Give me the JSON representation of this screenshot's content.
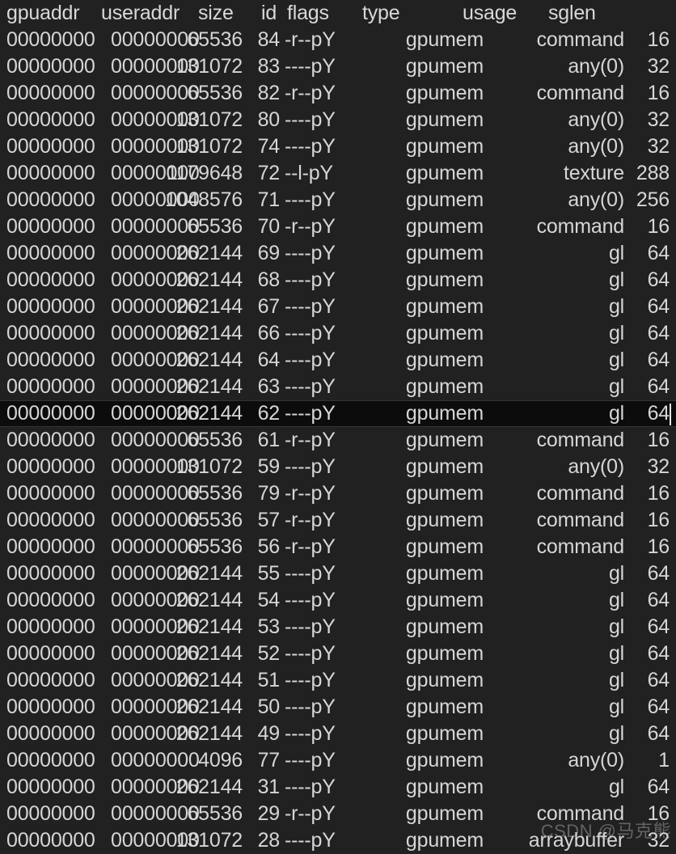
{
  "view": {
    "background_color": "#212121",
    "text_color": "#d6d6d6",
    "selected_row_background": "#0c0c0c",
    "selected_row_border_color": "#343434"
  },
  "table": {
    "headers": {
      "gpuaddr": "gpuaddr",
      "useraddr": "useraddr",
      "size": "size",
      "id": "id",
      "flags": "flags",
      "type": "type",
      "usage": "usage",
      "sglen": "sglen"
    },
    "rows": [
      {
        "gpuaddr": "00000000",
        "useraddr": "00000000",
        "size": "65536",
        "id": "84",
        "flags": "-r--pY",
        "type": "gpumem",
        "usage": "command",
        "sglen": "16",
        "selected": false
      },
      {
        "gpuaddr": "00000000",
        "useraddr": "00000000",
        "size": "131072",
        "id": "83",
        "flags": "----pY",
        "type": "gpumem",
        "usage": "any(0)",
        "sglen": "32",
        "selected": false
      },
      {
        "gpuaddr": "00000000",
        "useraddr": "00000000",
        "size": "65536",
        "id": "82",
        "flags": "-r--pY",
        "type": "gpumem",
        "usage": "command",
        "sglen": "16",
        "selected": false
      },
      {
        "gpuaddr": "00000000",
        "useraddr": "00000000",
        "size": "131072",
        "id": "80",
        "flags": "----pY",
        "type": "gpumem",
        "usage": "any(0)",
        "sglen": "32",
        "selected": false
      },
      {
        "gpuaddr": "00000000",
        "useraddr": "00000000",
        "size": "131072",
        "id": "74",
        "flags": "----pY",
        "type": "gpumem",
        "usage": "any(0)",
        "sglen": "32",
        "selected": false
      },
      {
        "gpuaddr": "00000000",
        "useraddr": "00000000",
        "size": "1179648",
        "id": "72",
        "flags": "--l-pY",
        "type": "gpumem",
        "usage": "texture",
        "sglen": "288",
        "selected": false
      },
      {
        "gpuaddr": "00000000",
        "useraddr": "00000000",
        "size": "1048576",
        "id": "71",
        "flags": "----pY",
        "type": "gpumem",
        "usage": "any(0)",
        "sglen": "256",
        "selected": false
      },
      {
        "gpuaddr": "00000000",
        "useraddr": "00000000",
        "size": "65536",
        "id": "70",
        "flags": "-r--pY",
        "type": "gpumem",
        "usage": "command",
        "sglen": "16",
        "selected": false
      },
      {
        "gpuaddr": "00000000",
        "useraddr": "00000000",
        "size": "262144",
        "id": "69",
        "flags": "----pY",
        "type": "gpumem",
        "usage": "gl",
        "sglen": "64",
        "selected": false
      },
      {
        "gpuaddr": "00000000",
        "useraddr": "00000000",
        "size": "262144",
        "id": "68",
        "flags": "----pY",
        "type": "gpumem",
        "usage": "gl",
        "sglen": "64",
        "selected": false
      },
      {
        "gpuaddr": "00000000",
        "useraddr": "00000000",
        "size": "262144",
        "id": "67",
        "flags": "----pY",
        "type": "gpumem",
        "usage": "gl",
        "sglen": "64",
        "selected": false
      },
      {
        "gpuaddr": "00000000",
        "useraddr": "00000000",
        "size": "262144",
        "id": "66",
        "flags": "----pY",
        "type": "gpumem",
        "usage": "gl",
        "sglen": "64",
        "selected": false
      },
      {
        "gpuaddr": "00000000",
        "useraddr": "00000000",
        "size": "262144",
        "id": "64",
        "flags": "----pY",
        "type": "gpumem",
        "usage": "gl",
        "sglen": "64",
        "selected": false
      },
      {
        "gpuaddr": "00000000",
        "useraddr": "00000000",
        "size": "262144",
        "id": "63",
        "flags": "----pY",
        "type": "gpumem",
        "usage": "gl",
        "sglen": "64",
        "selected": false
      },
      {
        "gpuaddr": "00000000",
        "useraddr": "00000000",
        "size": "262144",
        "id": "62",
        "flags": "----pY",
        "type": "gpumem",
        "usage": "gl",
        "sglen": "64",
        "selected": true
      },
      {
        "gpuaddr": "00000000",
        "useraddr": "00000000",
        "size": "65536",
        "id": "61",
        "flags": "-r--pY",
        "type": "gpumem",
        "usage": "command",
        "sglen": "16",
        "selected": false
      },
      {
        "gpuaddr": "00000000",
        "useraddr": "00000000",
        "size": "131072",
        "id": "59",
        "flags": "----pY",
        "type": "gpumem",
        "usage": "any(0)",
        "sglen": "32",
        "selected": false
      },
      {
        "gpuaddr": "00000000",
        "useraddr": "00000000",
        "size": "65536",
        "id": "79",
        "flags": "-r--pY",
        "type": "gpumem",
        "usage": "command",
        "sglen": "16",
        "selected": false
      },
      {
        "gpuaddr": "00000000",
        "useraddr": "00000000",
        "size": "65536",
        "id": "57",
        "flags": "-r--pY",
        "type": "gpumem",
        "usage": "command",
        "sglen": "16",
        "selected": false
      },
      {
        "gpuaddr": "00000000",
        "useraddr": "00000000",
        "size": "65536",
        "id": "56",
        "flags": "-r--pY",
        "type": "gpumem",
        "usage": "command",
        "sglen": "16",
        "selected": false
      },
      {
        "gpuaddr": "00000000",
        "useraddr": "00000000",
        "size": "262144",
        "id": "55",
        "flags": "----pY",
        "type": "gpumem",
        "usage": "gl",
        "sglen": "64",
        "selected": false
      },
      {
        "gpuaddr": "00000000",
        "useraddr": "00000000",
        "size": "262144",
        "id": "54",
        "flags": "----pY",
        "type": "gpumem",
        "usage": "gl",
        "sglen": "64",
        "selected": false
      },
      {
        "gpuaddr": "00000000",
        "useraddr": "00000000",
        "size": "262144",
        "id": "53",
        "flags": "----pY",
        "type": "gpumem",
        "usage": "gl",
        "sglen": "64",
        "selected": false
      },
      {
        "gpuaddr": "00000000",
        "useraddr": "00000000",
        "size": "262144",
        "id": "52",
        "flags": "----pY",
        "type": "gpumem",
        "usage": "gl",
        "sglen": "64",
        "selected": false
      },
      {
        "gpuaddr": "00000000",
        "useraddr": "00000000",
        "size": "262144",
        "id": "51",
        "flags": "----pY",
        "type": "gpumem",
        "usage": "gl",
        "sglen": "64",
        "selected": false
      },
      {
        "gpuaddr": "00000000",
        "useraddr": "00000000",
        "size": "262144",
        "id": "50",
        "flags": "----pY",
        "type": "gpumem",
        "usage": "gl",
        "sglen": "64",
        "selected": false
      },
      {
        "gpuaddr": "00000000",
        "useraddr": "00000000",
        "size": "262144",
        "id": "49",
        "flags": "----pY",
        "type": "gpumem",
        "usage": "gl",
        "sglen": "64",
        "selected": false
      },
      {
        "gpuaddr": "00000000",
        "useraddr": "00000000",
        "size": "4096",
        "id": "77",
        "flags": "----pY",
        "type": "gpumem",
        "usage": "any(0)",
        "sglen": "1",
        "selected": false
      },
      {
        "gpuaddr": "00000000",
        "useraddr": "00000000",
        "size": "262144",
        "id": "31",
        "flags": "----pY",
        "type": "gpumem",
        "usage": "gl",
        "sglen": "64",
        "selected": false
      },
      {
        "gpuaddr": "00000000",
        "useraddr": "00000000",
        "size": "65536",
        "id": "29",
        "flags": "-r--pY",
        "type": "gpumem",
        "usage": "command",
        "sglen": "16",
        "selected": false
      },
      {
        "gpuaddr": "00000000",
        "useraddr": "00000000",
        "size": "131072",
        "id": "28",
        "flags": "----pY",
        "type": "gpumem",
        "usage": "arraybuffer",
        "sglen": "32",
        "selected": false
      }
    ]
  },
  "watermark": {
    "text": "CSDN @马克熊"
  }
}
